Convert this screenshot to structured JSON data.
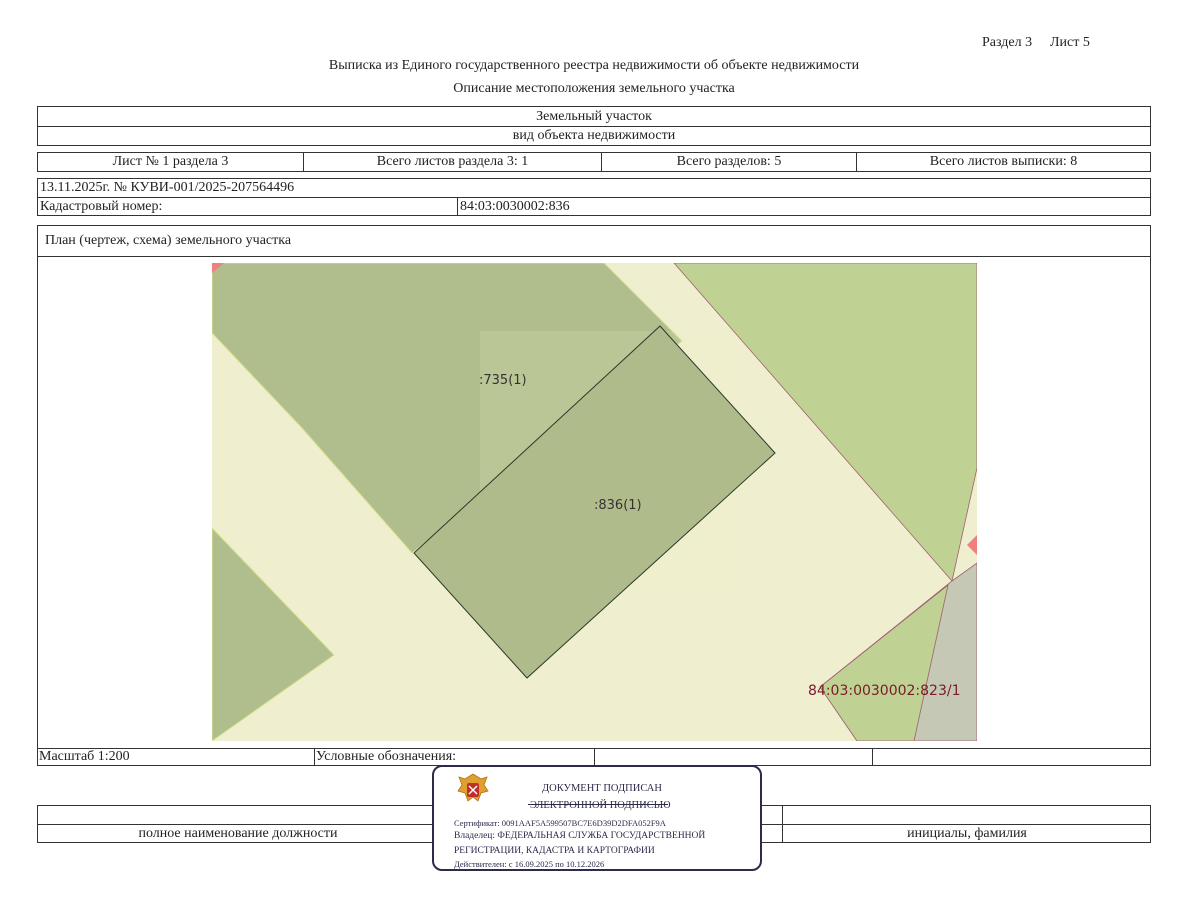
{
  "header": {
    "section": "Раздел 3",
    "sheet": "Лист 5",
    "title": "Выписка из Единого государственного реестра недвижимости об объекте недвижимости",
    "subtitle": "Описание местоположения земельного участка"
  },
  "object": {
    "type": "Земельный участок",
    "type_caption": "вид объекта недвижимости"
  },
  "sheets_row": {
    "sheet_of_section": "Лист № 1 раздела 3",
    "total_section_sheets": "Всего листов раздела 3: 1",
    "total_sections": "Всего разделов: 5",
    "total_extract_sheets": "Всего листов выписки: 8"
  },
  "meta": {
    "date_number": "13.11.2025г. № КУВИ-001/2025-207564496",
    "cadastral_label": "Кадастровый номер:",
    "cadastral_value": "84:03:0030002:836"
  },
  "plan": {
    "title": "План (чертеж, схема) земельного участка",
    "labels": {
      "parcel_735": ":735(1)",
      "parcel_836": ":836(1)",
      "parcel_823": "84:03:0030002:823/1"
    },
    "colors": {
      "background": "#efefcf",
      "parcel_dark": "#b0bd8c",
      "parcel_green": "#bfd293",
      "grey": "#c4c8b4",
      "marker_red": "#f08080",
      "label_red": "#7a1a2a"
    }
  },
  "footer": {
    "scale": "Масштаб 1:200",
    "legend": "Условные обозначения:",
    "position_caption": "полное наименование должности",
    "name_caption": "инициалы, фамилия"
  },
  "stamp": {
    "line1": "ДОКУМЕНТ ПОДПИСАН",
    "line2": "ЭЛЕКТРОННОЙ ПОДПИСЬЮ",
    "certificate": "Сертификат: 0091AAF5A599507BC7E6D39D2DFA052F9A",
    "owner": "Владелец: ФЕДЕРАЛЬНАЯ СЛУЖБА ГОСУДАРСТВЕННОЙ",
    "owner2": "РЕГИСТРАЦИИ, КАДАСТРА И КАРТОГРАФИИ",
    "valid": "Действителен: с 16.09.2025 по 10.12.2026"
  }
}
